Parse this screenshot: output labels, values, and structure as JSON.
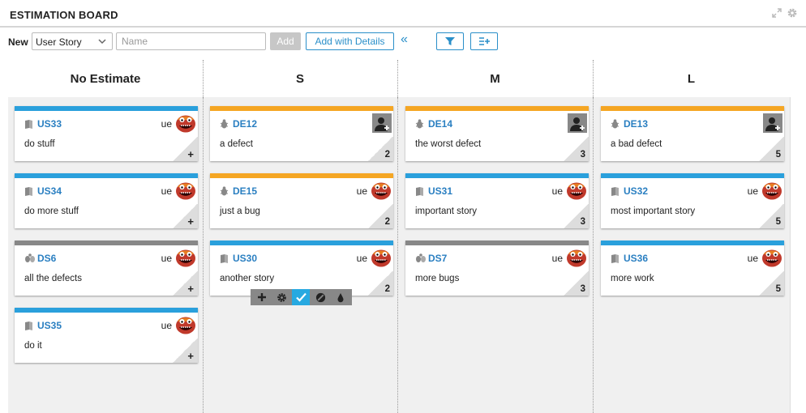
{
  "header": {
    "title": "ESTIMATION BOARD",
    "expand_icon": "expand-icon",
    "settings_icon": "gear-icon"
  },
  "toolbar": {
    "new_label": "New",
    "type_selected": "User Story",
    "name_placeholder": "Name",
    "name_value": "",
    "add_label": "Add",
    "add_details_label": "Add with Details",
    "collapse_glyph": "«",
    "filter_icon": "filter-icon",
    "fields_icon": "fields-icon"
  },
  "columns": [
    {
      "title": "No Estimate"
    },
    {
      "title": "S"
    },
    {
      "title": "M"
    },
    {
      "title": "L"
    }
  ],
  "cards": [
    {
      "id": "US33",
      "name": "do stuff",
      "owner": "ue",
      "estimate": "+",
      "type": "story"
    },
    {
      "id": "US34",
      "name": "do more stuff",
      "owner": "ue",
      "estimate": "+",
      "type": "story"
    },
    {
      "id": "DS6",
      "name": "all the defects",
      "owner": "ue",
      "estimate": "+",
      "type": "set"
    },
    {
      "id": "US35",
      "name": "do it",
      "owner": "ue",
      "estimate": "+",
      "type": "story"
    },
    {
      "id": "DE12",
      "name": "a defect",
      "owner": "",
      "estimate": "2",
      "type": "defect"
    },
    {
      "id": "DE15",
      "name": "just a bug",
      "owner": "ue",
      "estimate": "2",
      "type": "defect"
    },
    {
      "id": "US30",
      "name": "another story",
      "owner": "ue",
      "estimate": "2",
      "type": "story"
    },
    {
      "id": "DE14",
      "name": "the worst defect",
      "owner": "",
      "estimate": "3",
      "type": "defect"
    },
    {
      "id": "US31",
      "name": "important story",
      "owner": "ue",
      "estimate": "3",
      "type": "story"
    },
    {
      "id": "DS7",
      "name": "more bugs",
      "owner": "ue",
      "estimate": "3",
      "type": "set"
    },
    {
      "id": "DE13",
      "name": "a bad defect",
      "owner": "",
      "estimate": "5",
      "type": "defect"
    },
    {
      "id": "US32",
      "name": "most important story",
      "owner": "ue",
      "estimate": "5",
      "type": "story"
    },
    {
      "id": "US36",
      "name": "more work",
      "owner": "ue",
      "estimate": "5",
      "type": "story"
    }
  ],
  "card_tools": {
    "add": "plus-icon",
    "edit": "gear-icon",
    "ready": "check-icon",
    "block": "blocked-icon",
    "color": "color-drop-icon"
  },
  "colors": {
    "story": "#2aa0dc",
    "defect": "#f5a623",
    "set": "#888888",
    "link": "#2a7fc1",
    "active_tool": "#27a9e1"
  }
}
